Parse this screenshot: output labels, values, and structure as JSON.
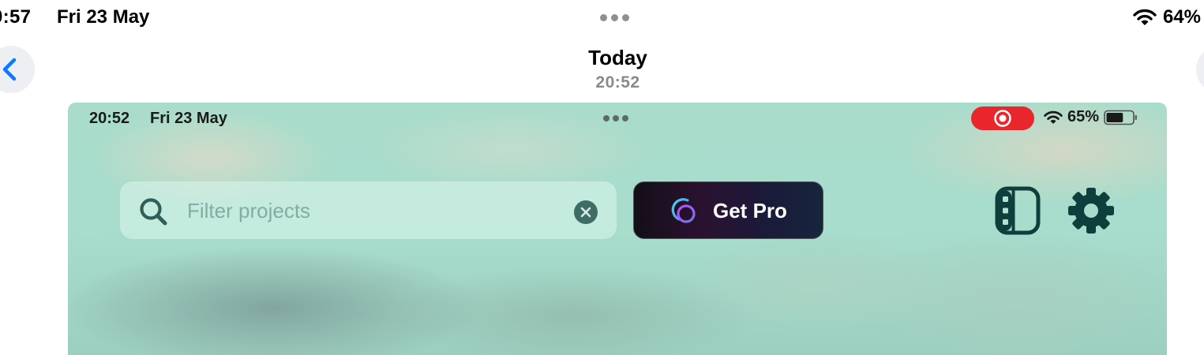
{
  "device_status": {
    "time": "0:57",
    "date": "Fri 23 May",
    "battery": "64%"
  },
  "nav": {
    "title": "Today",
    "subtitle": "20:52"
  },
  "screenshot": {
    "status": {
      "time": "20:52",
      "date": "Fri 23 May",
      "battery": "65%",
      "battery_level": 0.65,
      "recording_color": "#e8262b"
    },
    "search": {
      "placeholder": "Filter projects"
    },
    "get_pro": {
      "label": "Get Pro"
    },
    "toolbar_icons": [
      "film-strip-icon",
      "gear-icon"
    ],
    "accent_color": "#0f3f3c"
  }
}
